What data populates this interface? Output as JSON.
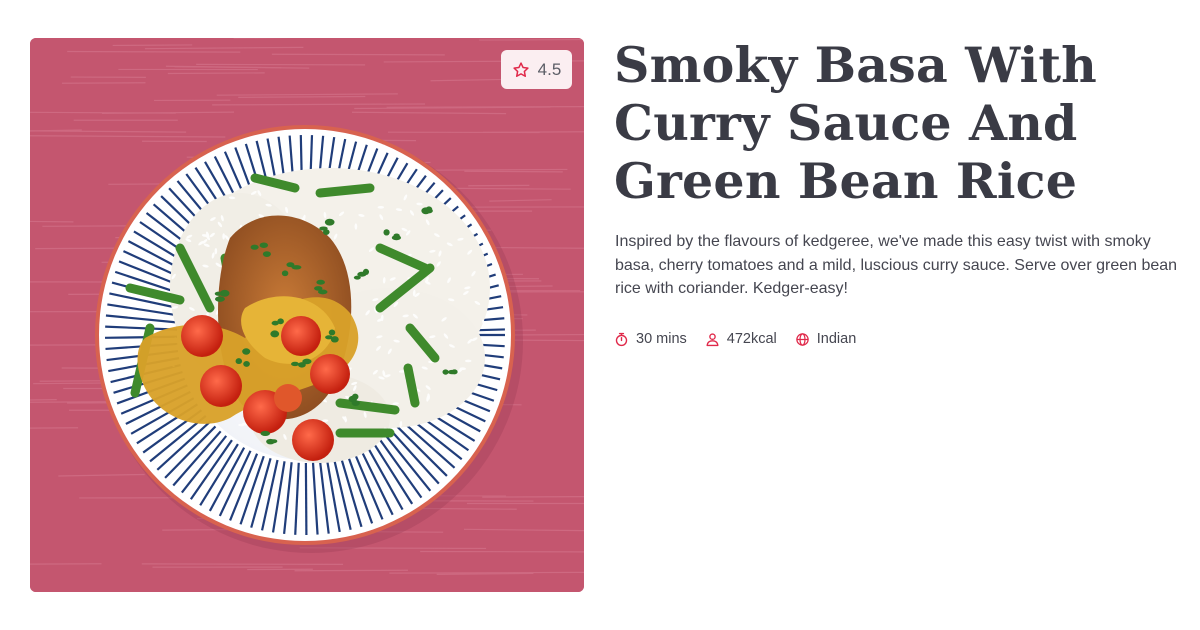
{
  "recipe": {
    "title": "Smoky Basa With Curry Sauce And Green Bean Rice",
    "description": "Inspired by the flavours of kedgeree, we've made this easy twist with smoky basa, cherry tomatoes and a mild, luscious curry sauce. Serve over green bean rice with coriander. Kedger-easy!",
    "rating": "4.5",
    "image_alt": "Smoky basa fillet with curry sauce, cherry tomatoes and green bean rice on a striped plate",
    "meta": {
      "time": "30 mins",
      "calories": "472kcal",
      "cuisine": "Indian"
    },
    "icons": {
      "rating": "star-icon",
      "time": "stopwatch-icon",
      "calories": "person-icon",
      "cuisine": "globe-icon"
    }
  },
  "colors": {
    "accent": "#e0294a",
    "title": "#3a3b45",
    "body_text": "#454650",
    "badge_bg": "#fbeef1",
    "photo_bg": "#c4566f"
  }
}
